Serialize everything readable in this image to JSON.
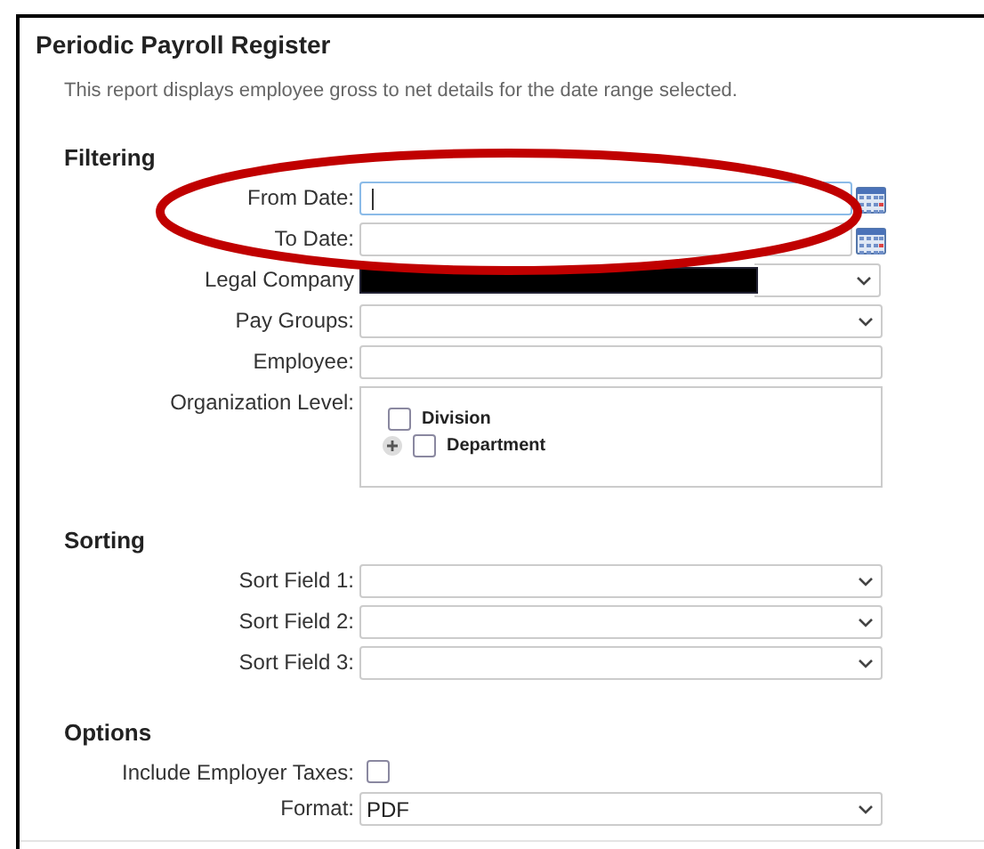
{
  "report": {
    "title": "Periodic Payroll Register",
    "description": "This report displays employee gross to net details for the date range selected."
  },
  "sections": [
    {
      "heading": "Filtering",
      "fields": [
        {
          "kind": "date",
          "label": "From Date:",
          "focused": true
        },
        {
          "kind": "date",
          "label": "To Date:",
          "focused": false
        },
        {
          "kind": "redacted",
          "label": "Legal Company"
        },
        {
          "kind": "select",
          "label": "Pay Groups:"
        },
        {
          "kind": "text",
          "label": "Employee:"
        },
        {
          "kind": "tree",
          "label": "Organization Level:",
          "items": [
            {
              "label": "Division",
              "checked": false,
              "expandable": false
            },
            {
              "label": "Department",
              "checked": false,
              "expandable": true
            }
          ]
        }
      ]
    },
    {
      "heading": "Sorting",
      "fields": [
        {
          "kind": "select",
          "label": "Sort Field 1:"
        },
        {
          "kind": "select",
          "label": "Sort Field 2:"
        },
        {
          "kind": "select",
          "label": "Sort Field 3:"
        }
      ]
    },
    {
      "heading": "Options",
      "fields": [
        {
          "kind": "checkbox",
          "label": "Include Employer Taxes:",
          "checked": false
        },
        {
          "kind": "select",
          "label": "Format:",
          "value": "PDF"
        }
      ]
    }
  ]
}
